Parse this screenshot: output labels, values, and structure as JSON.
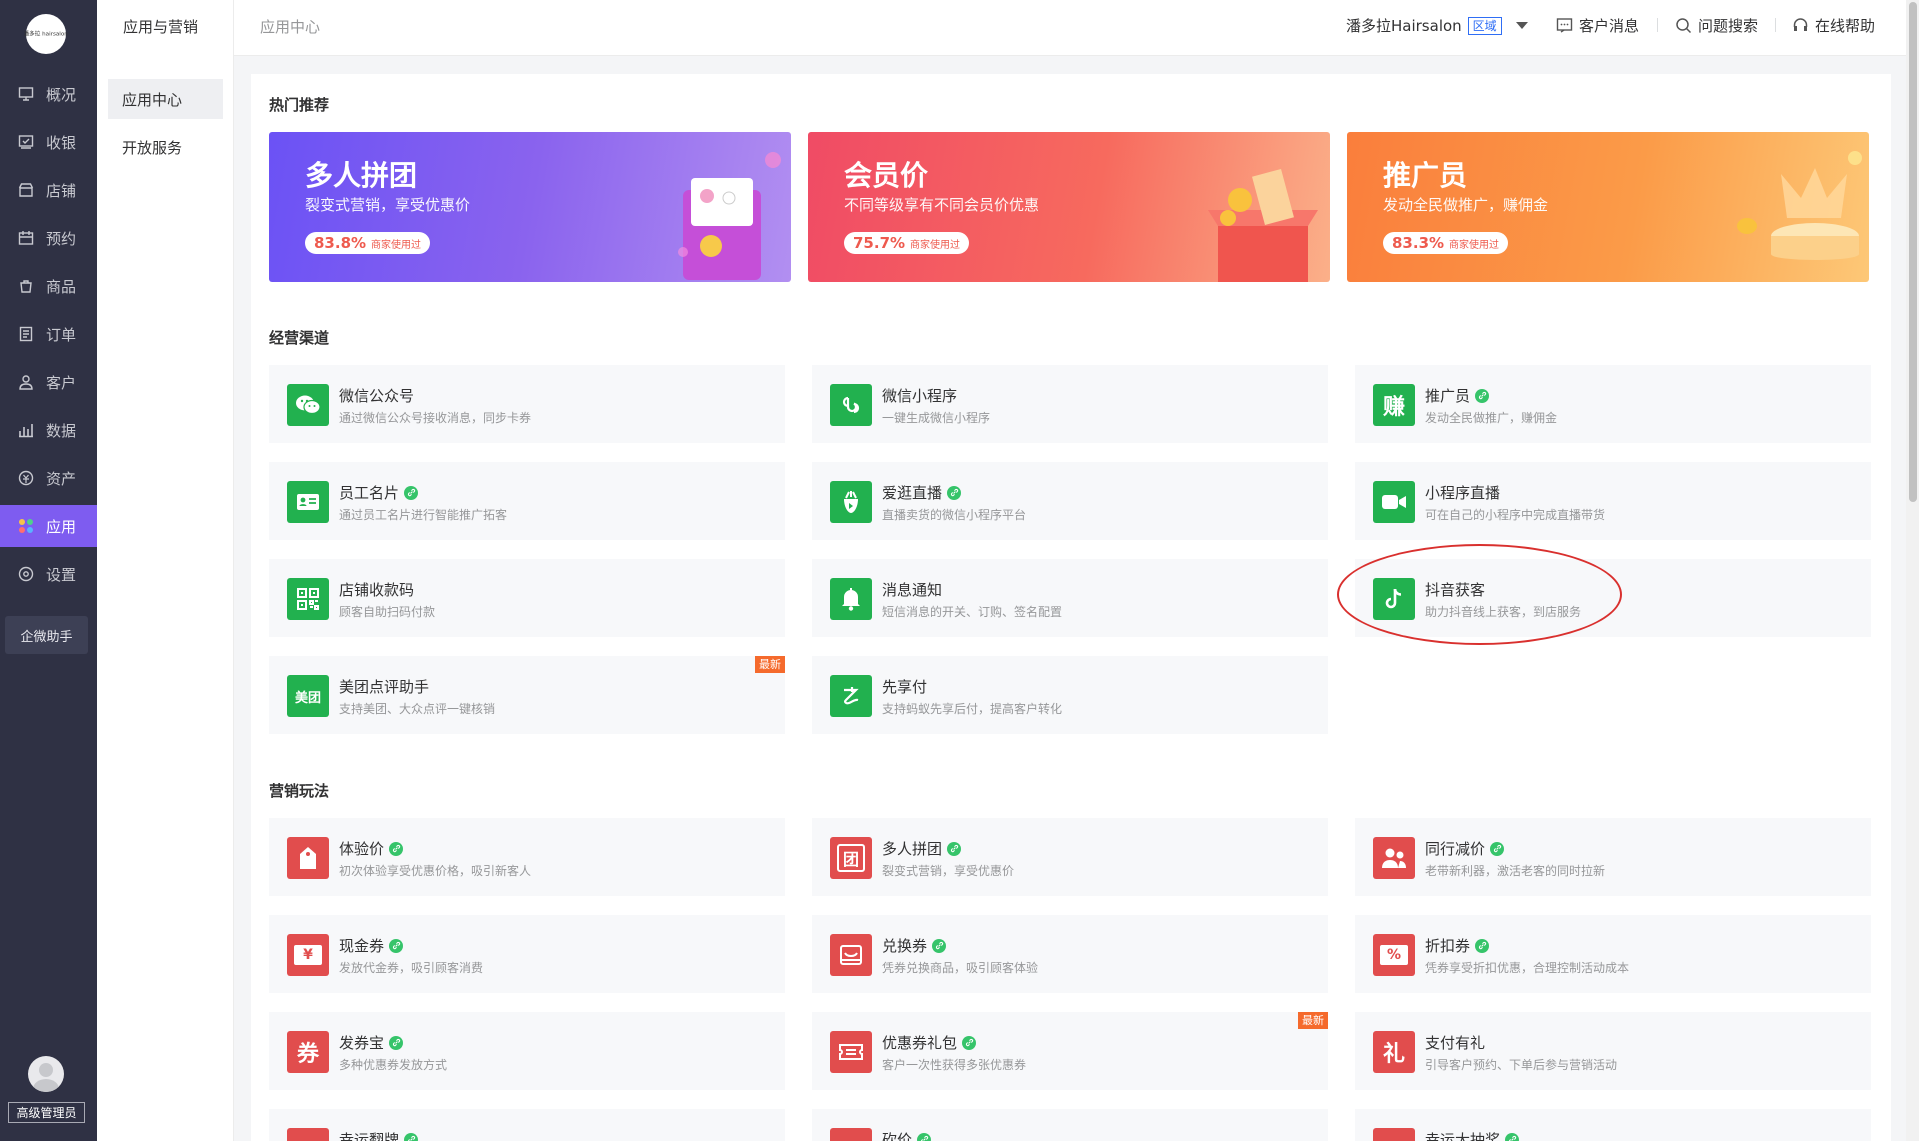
{
  "nav": {
    "logo": "潘多拉 hairsalon",
    "items": [
      {
        "label": "概况",
        "icon": "monitor-icon"
      },
      {
        "label": "收银",
        "icon": "cashier-icon"
      },
      {
        "label": "店铺",
        "icon": "store-icon"
      },
      {
        "label": "预约",
        "icon": "calendar-icon"
      },
      {
        "label": "商品",
        "icon": "bag-icon"
      },
      {
        "label": "订单",
        "icon": "order-icon"
      },
      {
        "label": "客户",
        "icon": "user-icon"
      },
      {
        "label": "数据",
        "icon": "chart-icon"
      },
      {
        "label": "资产",
        "icon": "coin-icon"
      },
      {
        "label": "应用",
        "icon": "apps-icon",
        "active": true
      },
      {
        "label": "设置",
        "icon": "gear-icon"
      }
    ],
    "assistant": "企微助手",
    "role": "高级管理员"
  },
  "subnav": {
    "title": "应用与营销",
    "items": [
      "应用中心",
      "开放服务"
    ]
  },
  "topbar": {
    "breadcrumb": "应用中心",
    "shop_name": "潘多拉Hairsalon",
    "shop_tag": "区域",
    "messages": "客户消息",
    "search": "问题搜索",
    "help": "在线帮助"
  },
  "hot": {
    "title": "热门推荐",
    "banners": [
      {
        "title": "多人拼团",
        "subtitle": "裂变式营销，享受优惠价",
        "percent": "83.8%",
        "pill_label": "商家使用过"
      },
      {
        "title": "会员价",
        "subtitle": "不同等级享有不同会员价优惠",
        "percent": "75.7%",
        "pill_label": "商家使用过"
      },
      {
        "title": "推广员",
        "subtitle": "发动全民做推广，赚佣金",
        "percent": "83.3%",
        "pill_label": "商家使用过"
      }
    ]
  },
  "channels": {
    "title": "经营渠道",
    "cards": [
      {
        "name": "微信公众号",
        "desc": "通过微信公众号接收消息，同步卡券",
        "icon": "wechat-icon",
        "linked": false,
        "is_new": false
      },
      {
        "name": "微信小程序",
        "desc": "一键生成微信小程序",
        "icon": "miniprogram-icon",
        "linked": false,
        "is_new": false
      },
      {
        "name": "推广员",
        "desc": "发动全民做推广，赚佣金",
        "icon": "earn-icon",
        "glyph": "赚",
        "linked": true,
        "is_new": false
      },
      {
        "name": "员工名片",
        "desc": "通过员工名片进行智能推广拓客",
        "icon": "namecard-icon",
        "linked": true,
        "is_new": false
      },
      {
        "name": "爱逛直播",
        "desc": "直播卖货的微信小程序平台",
        "icon": "live-icon",
        "linked": true,
        "is_new": false
      },
      {
        "name": "小程序直播",
        "desc": "可在自己的小程序中完成直播带货",
        "icon": "video-camera-icon",
        "linked": false,
        "is_new": false
      },
      {
        "name": "店铺收款码",
        "desc": "顾客自助扫码付款",
        "icon": "qrcode-icon",
        "linked": false,
        "is_new": false
      },
      {
        "name": "消息通知",
        "desc": "短信消息的开关、订购、签名配置",
        "icon": "bell-icon",
        "linked": false,
        "is_new": false
      },
      {
        "name": "抖音获客",
        "desc": "助力抖音线上获客，到店服务",
        "icon": "douyin-icon",
        "linked": false,
        "is_new": false
      },
      {
        "name": "美团点评助手",
        "desc": "支持美团、大众点评一键核销",
        "icon": "meituan-icon",
        "glyph": "美团",
        "linked": false,
        "is_new": true
      },
      {
        "name": "先享付",
        "desc": "支持蚂蚁先享后付，提高客户转化",
        "icon": "pay-later-icon",
        "linked": false,
        "is_new": false
      }
    ]
  },
  "marketing": {
    "title": "营销玩法",
    "cards": [
      {
        "name": "体验价",
        "desc": "初次体验享受优惠价格，吸引新客人",
        "icon": "price-tag-icon",
        "linked": true,
        "is_new": false
      },
      {
        "name": "多人拼团",
        "desc": "裂变式营销，享受优惠价",
        "icon": "group-buy-icon",
        "glyph": "团",
        "linked": true,
        "is_new": false
      },
      {
        "name": "同行减价",
        "desc": "老带新利器，激活老客的同时拉新",
        "icon": "friends-icon",
        "linked": true,
        "is_new": false
      },
      {
        "name": "现金券",
        "desc": "发放代金券，吸引顾客消费",
        "icon": "cash-coupon-icon",
        "glyph": "¥",
        "linked": true,
        "is_new": false
      },
      {
        "name": "兑换券",
        "desc": "凭券兑换商品，吸引顾客体验",
        "icon": "exchange-icon",
        "linked": true,
        "is_new": false
      },
      {
        "name": "折扣券",
        "desc": "凭券享受折扣优惠，合理控制活动成本",
        "icon": "discount-icon",
        "glyph": "%",
        "linked": true,
        "is_new": false
      },
      {
        "name": "发券宝",
        "desc": "多种优惠券发放方式",
        "icon": "coupon-icon",
        "glyph": "券",
        "linked": true,
        "is_new": false
      },
      {
        "name": "优惠券礼包",
        "desc": "客户一次性获得多张优惠券",
        "icon": "gift-pack-icon",
        "linked": true,
        "is_new": true
      },
      {
        "name": "支付有礼",
        "desc": "引导客户预约、下单后参与营销活动",
        "icon": "gift-icon",
        "glyph": "礼",
        "linked": false,
        "is_new": false
      },
      {
        "name": "幸运翻牌",
        "desc": "",
        "icon": "flip-card-icon",
        "linked": true,
        "is_new": false
      },
      {
        "name": "砍价",
        "desc": "",
        "icon": "bargain-icon",
        "linked": true,
        "is_new": false
      },
      {
        "name": "幸运大抽奖",
        "desc": "",
        "icon": "lottery-icon",
        "linked": true,
        "is_new": false
      }
    ]
  },
  "colors": {
    "nav_bg": "#2f3144",
    "active": "#7e5cf0",
    "channel_icon": "#22b14f",
    "marketing_icon": "#e14d4d",
    "new_badge": "#f56a2c",
    "annotation": "#d9302e"
  },
  "new_badge": "最新"
}
